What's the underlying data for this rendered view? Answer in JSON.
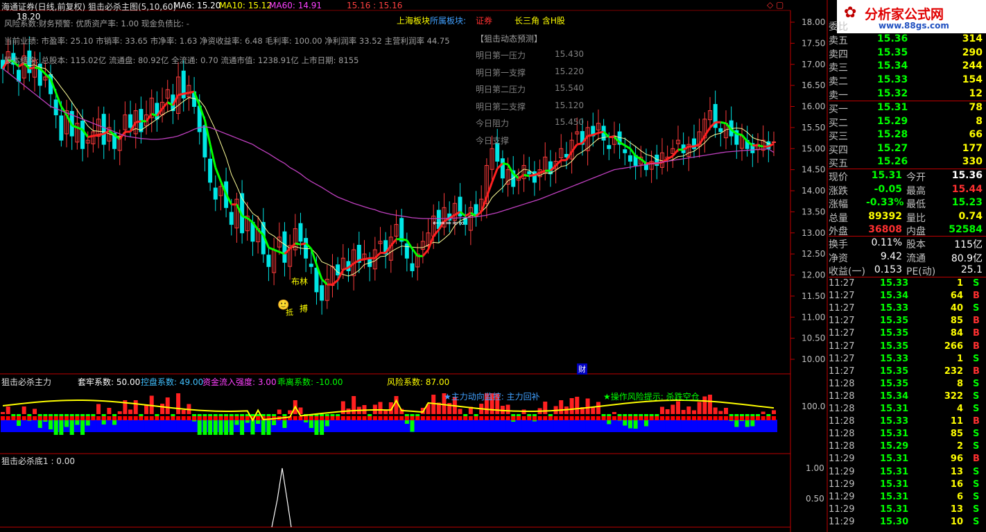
{
  "colors": {
    "up": "#ff3c3c",
    "down": "#00e6e6",
    "ma_main": "#ff2020",
    "ma_green": "#00ff00",
    "ma_white": "#ffff99",
    "ma60": "#c040c0",
    "axis": "#c00000",
    "yellow": "#ffff00",
    "cyan": "#40c0ff",
    "blue": "#0000ff",
    "green_val": "#00ff00"
  },
  "header": {
    "title": "海通证券(日线,前复权) 狙击必杀主图(5,10,60)",
    "ma6": "MA6: 15.20",
    "ma10": "MA10: 15.12",
    "ma60": "MA60: 14.91",
    "extra": "15.16 : 15.16",
    "sector1": "上海板块",
    "sector2": "所属板块:",
    "sector3": "证券",
    "sector4": "长三角 含H股",
    "high_label": "18.20"
  },
  "info_lines": [
    "风险系数:财务预警: 优质资产率: 1.00 现金负债比: -",
    "当前业绩: 市盈率: 25.10 市销率: 33.65 市净率: 1.63 净资收益率: 6.48 毛利率: 100.00 净利润率 33.52 主营利润率 44.75",
    "股本结构: 总股本: 115.02亿 流通盘: 80.92亿 全流通: 0.70 流通市值: 1238.91亿 上市日期: 8155"
  ],
  "forecast": {
    "title": "【狙击动态预测】",
    "rows": [
      {
        "label": "明日第一压力",
        "value": "15.430"
      },
      {
        "label": "明日第一支撑",
        "value": "15.220"
      },
      {
        "label": "明日第二压力",
        "value": "15.540"
      },
      {
        "label": "明日第二支撑",
        "value": "15.120"
      },
      {
        "label": "今日阻力",
        "value": "15.450"
      },
      {
        "label": "今日支撑",
        "value": ""
      }
    ]
  },
  "annotations": {
    "bulin": "布林",
    "bo": "搏",
    "zhi": "抵",
    "arrow": "←==≈∞",
    "cai": "财",
    "panel2_monitor": "★主力动向监控: 主力回补",
    "panel2_risk": "★操作风险提示: 杀跌空仓"
  },
  "panel2": {
    "title": "狙击必杀主力",
    "l1": "套牢系数: 50.00",
    "l2": "控盘系数: 49.00",
    "l3": "资金流入强度: 3.00",
    "l4": "乖离系数: -10.00",
    "l5": "风险系数: 87.00",
    "axis": "100.0"
  },
  "panel3": {
    "title": "狙击必杀底1 : 0.00",
    "axis": [
      "1.00",
      "0.50"
    ]
  },
  "main_axis": [
    "18.00",
    "17.50",
    "17.00",
    "16.50",
    "16.00",
    "15.50",
    "15.00",
    "14.50",
    "14.00",
    "13.50",
    "13.00",
    "12.50",
    "12.00",
    "11.50",
    "11.00",
    "10.50",
    "10.00"
  ],
  "logo": {
    "text": "分析家公式网",
    "url": "www.88gs.com"
  },
  "quote": {
    "asks": [
      {
        "label": "委比",
        "price": "",
        "vol": ""
      },
      {
        "label": "卖五",
        "price": "15.36",
        "vol": "314"
      },
      {
        "label": "卖四",
        "price": "15.35",
        "vol": "290"
      },
      {
        "label": "卖三",
        "price": "15.34",
        "vol": "244"
      },
      {
        "label": "卖二",
        "price": "15.33",
        "vol": "154"
      },
      {
        "label": "卖一",
        "price": "15.32",
        "vol": "12"
      }
    ],
    "bids": [
      {
        "label": "买一",
        "price": "15.31",
        "vol": "78"
      },
      {
        "label": "买二",
        "price": "15.29",
        "vol": "8"
      },
      {
        "label": "买三",
        "price": "15.28",
        "vol": "66"
      },
      {
        "label": "买四",
        "price": "15.27",
        "vol": "177"
      },
      {
        "label": "买五",
        "price": "15.26",
        "vol": "330"
      }
    ],
    "stats": [
      {
        "l1": "现价",
        "v1": "15.31",
        "l2": "今开",
        "v2": "15.36"
      },
      {
        "l1": "涨跌",
        "v1": "-0.05",
        "l2": "最高",
        "v2": "15.44"
      },
      {
        "l1": "涨幅",
        "v1": "-0.33%",
        "l2": "最低",
        "v2": "15.23"
      },
      {
        "l1": "总量",
        "v1": "89392",
        "l2": "量比",
        "v2": "0.74"
      },
      {
        "l1": "外盘",
        "v1": "36808",
        "l2": "内盘",
        "v2": "52584"
      }
    ],
    "stats2": [
      {
        "l1": "换手",
        "v1": "0.11%",
        "l2": "股本",
        "v2": "115亿"
      },
      {
        "l1": "净资",
        "v1": "9.42",
        "l2": "流通",
        "v2": "80.9亿"
      },
      {
        "l1": "收益(一)",
        "v1": "0.153",
        "l2": "PE(动)",
        "v2": "25.1"
      }
    ],
    "ticks": [
      {
        "t": "11:27",
        "p": "15.33",
        "v": "1",
        "s": "S"
      },
      {
        "t": "11:27",
        "p": "15.34",
        "v": "64",
        "s": "B"
      },
      {
        "t": "11:27",
        "p": "15.33",
        "v": "40",
        "s": "S"
      },
      {
        "t": "11:27",
        "p": "15.35",
        "v": "85",
        "s": "B"
      },
      {
        "t": "11:27",
        "p": "15.35",
        "v": "84",
        "s": "B"
      },
      {
        "t": "11:27",
        "p": "15.35",
        "v": "266",
        "s": "B"
      },
      {
        "t": "11:27",
        "p": "15.33",
        "v": "1",
        "s": "S"
      },
      {
        "t": "11:27",
        "p": "15.35",
        "v": "232",
        "s": "B"
      },
      {
        "t": "11:28",
        "p": "15.35",
        "v": "8",
        "s": "S"
      },
      {
        "t": "11:28",
        "p": "15.34",
        "v": "322",
        "s": "S"
      },
      {
        "t": "11:28",
        "p": "15.31",
        "v": "4",
        "s": "S"
      },
      {
        "t": "11:28",
        "p": "15.33",
        "v": "11",
        "s": "B"
      },
      {
        "t": "11:28",
        "p": "15.31",
        "v": "85",
        "s": "S"
      },
      {
        "t": "11:28",
        "p": "15.29",
        "v": "2",
        "s": "S"
      },
      {
        "t": "11:29",
        "p": "15.31",
        "v": "96",
        "s": "B"
      },
      {
        "t": "11:29",
        "p": "15.31",
        "v": "13",
        "s": "S"
      },
      {
        "t": "11:29",
        "p": "15.31",
        "v": "16",
        "s": "S"
      },
      {
        "t": "11:29",
        "p": "15.31",
        "v": "6",
        "s": "S"
      },
      {
        "t": "11:29",
        "p": "15.31",
        "v": "13",
        "s": "S"
      },
      {
        "t": "11:29",
        "p": "15.30",
        "v": "10",
        "s": "S"
      }
    ]
  },
  "chart_data": {
    "type": "candlestick",
    "ylim": [
      9.8,
      18.2
    ],
    "closes": [
      16.9,
      17.3,
      17.0,
      16.6,
      17.2,
      16.8,
      17.1,
      16.5,
      16.7,
      16.3,
      15.8,
      15.2,
      15.9,
      15.3,
      15.6,
      15.0,
      15.2,
      15.4,
      15.7,
      15.1,
      15.5,
      15.0,
      15.3,
      15.8,
      15.5,
      15.9,
      15.4,
      15.8,
      16.2,
      15.7,
      16.1,
      16.4,
      15.9,
      16.7,
      16.2,
      16.5,
      16.0,
      15.4,
      14.8,
      14.2,
      13.8,
      14.1,
      13.6,
      13.2,
      13.8,
      13.0,
      13.4,
      12.8,
      13.1,
      12.5,
      12.2,
      12.6,
      12.9,
      12.3,
      12.7,
      13.1,
      12.8,
      12.4,
      12.2,
      11.6,
      11.4,
      11.9,
      12.2,
      12.0,
      12.4,
      12.1,
      12.6,
      12.3,
      12.5,
      12.2,
      12.6,
      12.8,
      12.5,
      12.9,
      13.2,
      12.8,
      12.4,
      12.1,
      12.5,
      12.8,
      13.0,
      13.4,
      13.1,
      13.6,
      13.3,
      13.7,
      13.4,
      13.2,
      13.6,
      13.4,
      13.8,
      14.6,
      15.0,
      14.7,
      14.3,
      14.5,
      14.1,
      14.3,
      14.6,
      14.4,
      14.2,
      14.5,
      14.8,
      14.4,
      14.7,
      15.0,
      14.8,
      15.2,
      15.4,
      15.1,
      15.5,
      15.3,
      15.6,
      15.2,
      15.0,
      15.3,
      15.1,
      14.9,
      14.7,
      14.6,
      14.8,
      14.5,
      14.7,
      14.6,
      14.9,
      14.8,
      15.0,
      15.2,
      14.9,
      15.1,
      15.0,
      15.4,
      15.7,
      15.9,
      15.5,
      15.4,
      15.6,
      15.3,
      15.1,
      15.3,
      15.0,
      14.9,
      15.1,
      15.2,
      15.0,
      15.16
    ],
    "ma60": [
      16.9,
      16.8,
      16.7,
      16.6,
      16.5,
      16.4,
      16.3,
      16.2,
      16.1,
      16.0,
      15.95,
      15.9,
      15.85,
      15.8,
      15.75,
      15.7,
      15.65,
      15.6,
      15.55,
      15.5,
      15.45,
      15.4,
      15.35,
      15.3,
      15.28,
      15.26,
      15.24,
      15.23,
      15.22,
      15.22,
      15.23,
      15.25,
      15.27,
      15.3,
      15.35,
      15.4,
      15.46,
      15.5,
      15.52,
      15.5,
      15.45,
      15.4,
      15.35,
      15.3,
      15.25,
      15.2,
      15.15,
      15.1,
      15.02,
      14.95,
      14.88,
      14.8,
      14.72,
      14.65,
      14.55,
      14.48,
      14.4,
      14.3,
      14.22,
      14.15,
      14.08,
      14.0,
      13.92,
      13.85,
      13.8,
      13.75,
      13.7,
      13.66,
      13.62,
      13.58,
      13.55,
      13.5,
      13.47,
      13.44,
      13.42,
      13.4,
      13.38,
      13.36,
      13.35,
      13.34,
      13.34,
      13.34,
      13.34,
      13.34,
      13.35,
      13.35,
      13.36,
      13.36,
      13.37,
      13.38,
      13.4,
      13.42,
      13.45,
      13.48,
      13.52,
      13.56,
      13.6,
      13.64,
      13.68,
      13.72,
      13.76,
      13.8,
      13.85,
      13.9,
      13.95,
      14.0,
      14.05,
      14.1,
      14.15,
      14.2,
      14.25,
      14.3,
      14.35,
      14.4,
      14.45,
      14.5,
      14.52,
      14.54,
      14.56,
      14.58,
      14.6,
      14.62,
      14.64,
      14.66,
      14.68,
      14.7,
      14.72,
      14.74,
      14.76,
      14.78,
      14.8,
      14.82,
      14.84,
      14.86,
      14.88,
      14.9,
      14.92,
      14.93,
      14.94,
      14.95,
      14.96,
      14.97,
      14.98,
      14.99,
      14.99,
      14.91
    ]
  }
}
